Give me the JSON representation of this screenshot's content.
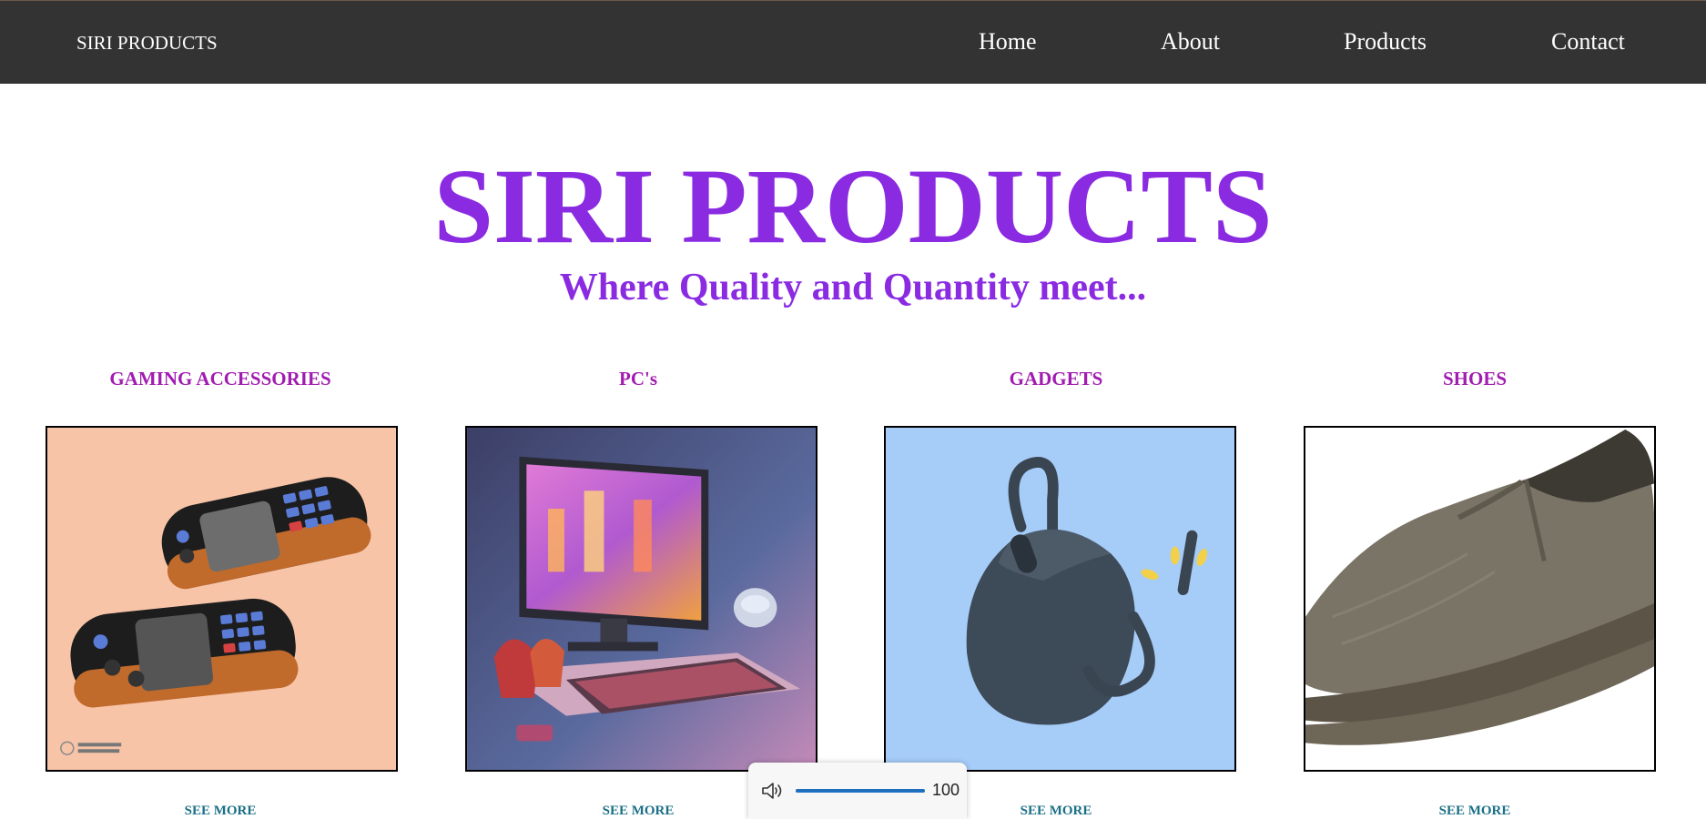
{
  "colors": {
    "nav_bg": "#333333",
    "nav_text": "#ffffff",
    "hero": "#8a2be2",
    "category_heading": "#a11cb0",
    "see_more": "#1a6f86",
    "volume_accent": "#1f6fbf"
  },
  "nav": {
    "brand": "SIRI PRODUCTS",
    "links": [
      "Home",
      "About",
      "Products",
      "Contact"
    ]
  },
  "hero": {
    "title": "SIRI PRODUCTS",
    "subtitle": "Where Quality and Quantity meet..."
  },
  "categories": [
    {
      "heading": "GAMING ACCESSORIES",
      "image": "handheld-game-consoles",
      "see_more": "SEE MORE"
    },
    {
      "heading": "PC's",
      "image": "gaming-pc-setup",
      "see_more": "SEE MORE"
    },
    {
      "heading": "GADGETS",
      "image": "computer-mouse",
      "see_more": "SEE MORE"
    },
    {
      "heading": "SHOES",
      "image": "slip-on-shoe",
      "see_more": "SEE MORE"
    }
  ],
  "volume_overlay": {
    "icon": "speaker-icon",
    "level": 100,
    "value_text": "100"
  }
}
